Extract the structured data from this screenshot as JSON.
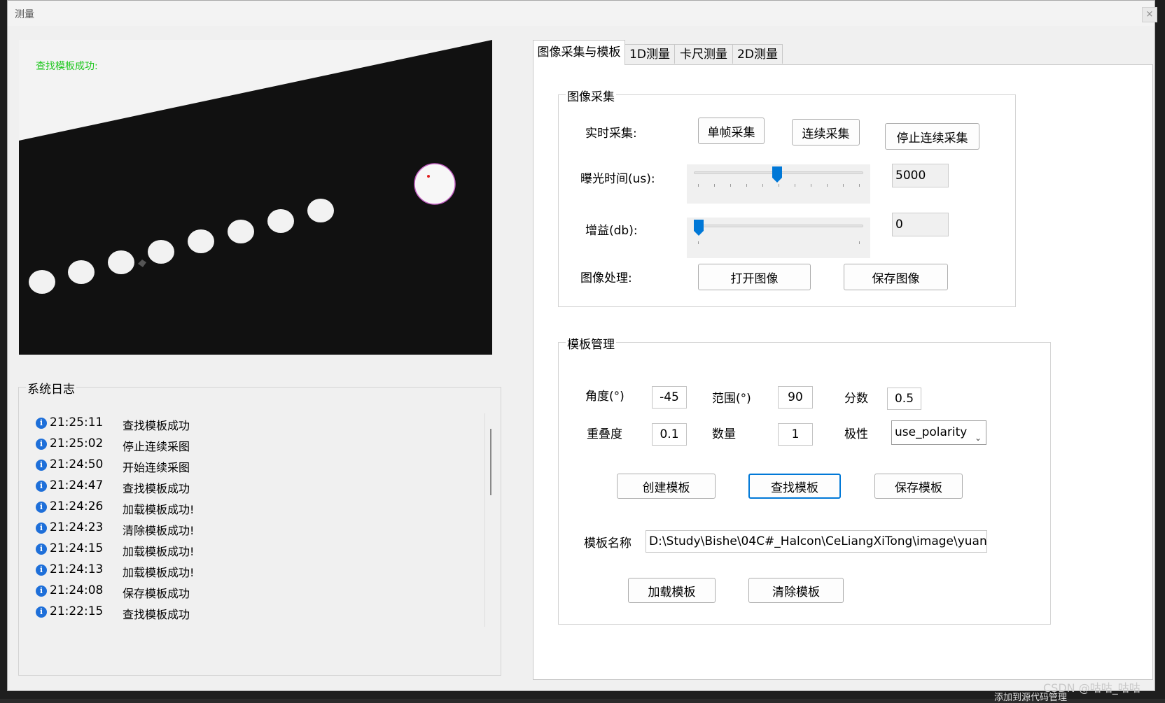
{
  "window": {
    "title": "测量",
    "close_label": "×"
  },
  "background": {
    "watermark": "CSDN @咕咕_咕咕",
    "status_text": "添加到源代码管理"
  },
  "viewer": {
    "status": "查找模板成功:"
  },
  "log": {
    "title": "系统日志",
    "entries": [
      {
        "time": "21:25:11",
        "message": "查找模板成功"
      },
      {
        "time": "21:25:02",
        "message": "停止连续采图"
      },
      {
        "time": "21:24:50",
        "message": "开始连续采图"
      },
      {
        "time": "21:24:47",
        "message": "查找模板成功"
      },
      {
        "time": "21:24:26",
        "message": "加载模板成功!"
      },
      {
        "time": "21:24:23",
        "message": "清除模板成功!"
      },
      {
        "time": "21:24:15",
        "message": "加载模板成功!"
      },
      {
        "time": "21:24:13",
        "message": "加载模板成功!"
      },
      {
        "time": "21:24:08",
        "message": "保存模板成功"
      },
      {
        "time": "21:22:15",
        "message": "查找模板成功"
      }
    ]
  },
  "tabs": [
    "图像采集与模板",
    "1D测量",
    "卡尺测量",
    "2D测量"
  ],
  "acquisition": {
    "title": "图像采集",
    "realtime_label": "实时采集:",
    "single_frame_button": "单帧采集",
    "continuous_button": "连续采集",
    "stop_continuous_button": "停止连续采集",
    "exposure_label": "曝光时间(us):",
    "exposure_value": "5000",
    "exposure_slider_fraction": 0.49,
    "gain_label": "增益(db):",
    "gain_value": "0",
    "gain_slider_fraction": 0.0,
    "processing_label": "图像处理:",
    "open_image_button": "打开图像",
    "save_image_button": "保存图像"
  },
  "template": {
    "title": "模板管理",
    "angle_label": "角度(°)",
    "angle_value": "-45",
    "range_label": "范围(°)",
    "range_value": "90",
    "score_label": "分数",
    "score_value": "0.5",
    "overlap_label": "重叠度",
    "overlap_value": "0.1",
    "count_label": "数量",
    "count_value": "1",
    "polarity_label": "极性",
    "polarity_value": "use_polarity",
    "create_button": "创建模板",
    "find_button": "查找模板",
    "save_button": "保存模板",
    "name_label": "模板名称",
    "name_value": "D:\\Study\\Bishe\\04C#_Halcon\\CeLiangXiTong\\image\\yuan",
    "load_button": "加载模板",
    "clear_button": "清除模板"
  },
  "colors": {
    "accent": "#0078d7",
    "status_green": "#1ec71e",
    "info_icon": "#1e6fd9"
  }
}
